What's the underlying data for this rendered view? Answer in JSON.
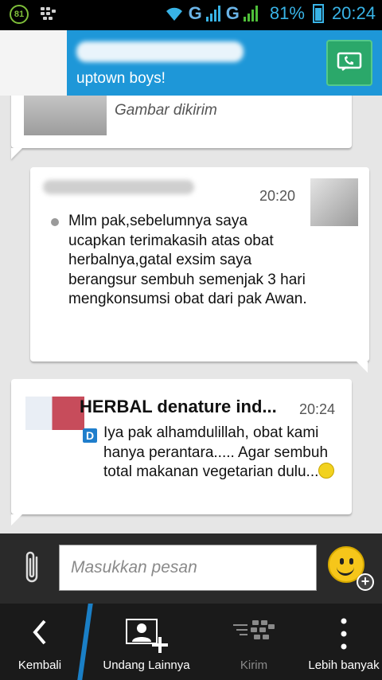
{
  "status_bar": {
    "notification_count": "81",
    "network_1": "G",
    "network_2": "G",
    "battery": "81%",
    "time": "20:24"
  },
  "chat_header": {
    "subtitle": "uptown boys!"
  },
  "messages": [
    {
      "type": "image",
      "caption": "Gambar dikirim"
    },
    {
      "type": "incoming",
      "time": "20:20",
      "text": "Mlm pak,sebelumnya saya ucapkan terimakasih atas obat herbalnya,gatal exsim saya berangsur sembuh semenjak 3 hari mengkonsumsi obat dari pak Awan."
    },
    {
      "type": "outgoing",
      "sender": "HERBAL denature ind...",
      "time": "20:24",
      "text": "Iya pak alhamdulillah, obat kami hanya perantara..... Agar sembuh total makanan vegetarian dulu..."
    }
  ],
  "composer": {
    "placeholder": "Masukkan pesan"
  },
  "actions": {
    "back": "Kembali",
    "invite": "Undang Lainnya",
    "send": "Kirim",
    "more": "Lebih banyak"
  },
  "colors": {
    "accent": "#1e97d8",
    "call_button": "#2ba86a",
    "status_icons": "#38b3e6"
  },
  "icons": {
    "call": "phone-call-icon",
    "attach": "paperclip-icon",
    "emoji": "smiley-icon",
    "back": "chevron-left-icon",
    "invite": "add-contact-icon",
    "send": "bbm-send-icon",
    "more": "vertical-dots-icon"
  }
}
